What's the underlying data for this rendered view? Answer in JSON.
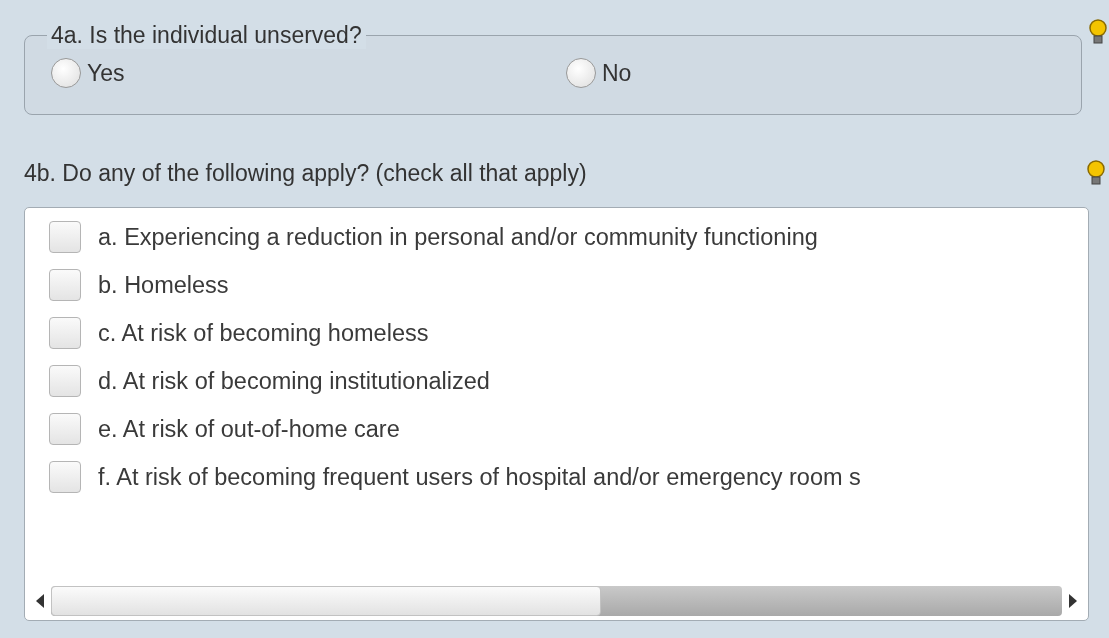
{
  "question_4a": {
    "legend": "4a.  Is the individual unserved?",
    "options": [
      {
        "label": "Yes",
        "selected": false
      },
      {
        "label": "No",
        "selected": false
      }
    ]
  },
  "question_4b": {
    "prompt": "4b. Do any of the following apply? (check all that apply)",
    "options": [
      {
        "label": "a. Experiencing a reduction in personal and/or community functioning",
        "checked": false
      },
      {
        "label": "b. Homeless",
        "checked": false
      },
      {
        "label": "c. At risk of becoming homeless",
        "checked": false
      },
      {
        "label": "d. At risk of becoming institutionalized",
        "checked": false
      },
      {
        "label": "e. At risk of out-of-home care",
        "checked": false
      },
      {
        "label": "f. At risk of becoming frequent users of hospital and/or emergency room s",
        "checked": false
      }
    ]
  }
}
